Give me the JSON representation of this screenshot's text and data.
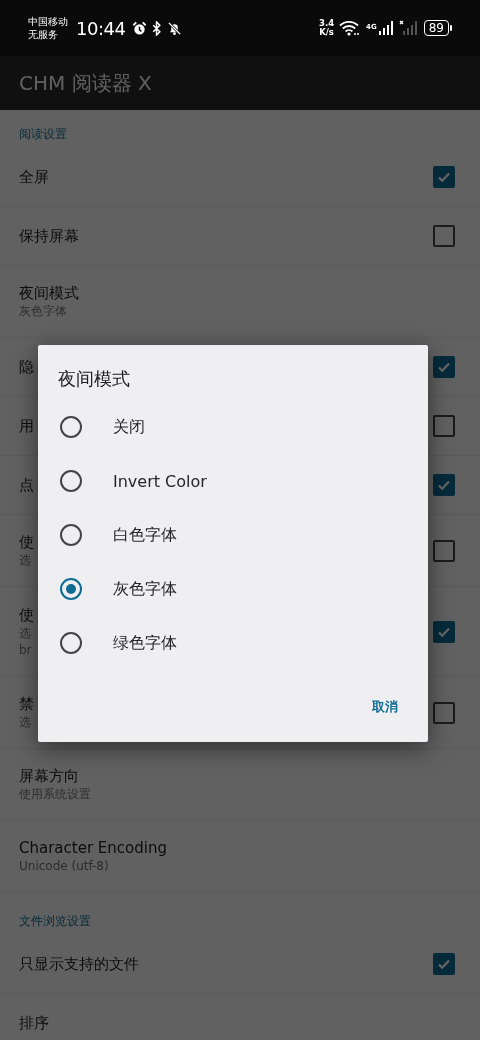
{
  "status_bar": {
    "carrier": "中国移动",
    "service": "无服务",
    "time": "10:44",
    "speed_value": "3.4",
    "speed_unit": "K/s",
    "network_type": "4G",
    "battery": "89"
  },
  "app_bar": {
    "title": "CHM 阅读器 X"
  },
  "sections": [
    {
      "title": "阅读设置",
      "items": [
        {
          "kind": "checkbox",
          "title": "全屏",
          "checked": true
        },
        {
          "kind": "checkbox",
          "title": "保持屏幕",
          "checked": false
        },
        {
          "kind": "plain",
          "title": "夜间模式",
          "subtitle_lines": [
            "灰色字体"
          ]
        },
        {
          "kind": "checkbox",
          "title": "隐",
          "checked": true
        },
        {
          "kind": "checkbox",
          "title": "用",
          "checked": false
        },
        {
          "kind": "checkbox",
          "title": "点",
          "checked": true
        },
        {
          "kind": "checkbox",
          "title": "使",
          "subtitle_lines": [
            "选"
          ],
          "checked": false
        },
        {
          "kind": "checkbox",
          "title": "使",
          "subtitle_lines": [
            "选",
            "br"
          ],
          "checked": true
        },
        {
          "kind": "checkbox",
          "title": "禁",
          "subtitle_lines": [
            "选"
          ],
          "checked": false
        },
        {
          "kind": "plain",
          "title": "屏幕方向",
          "subtitle_lines": [
            "使用系统设置"
          ]
        },
        {
          "kind": "plain",
          "title": "Character Encoding",
          "subtitle_lines": [
            "Unicode (utf-8)"
          ]
        }
      ]
    },
    {
      "title": "文件浏览设置",
      "items": [
        {
          "kind": "checkbox",
          "title": "只显示支持的文件",
          "checked": true
        },
        {
          "kind": "plain",
          "title": "排序"
        }
      ]
    }
  ],
  "dialog": {
    "title": "夜间模式",
    "options": [
      {
        "label": "关闭",
        "selected": false
      },
      {
        "label": "Invert Color",
        "selected": false
      },
      {
        "label": "白色字体",
        "selected": false
      },
      {
        "label": "灰色字体",
        "selected": true
      },
      {
        "label": "绿色字体",
        "selected": false
      }
    ],
    "buttons": [
      "取消"
    ]
  }
}
